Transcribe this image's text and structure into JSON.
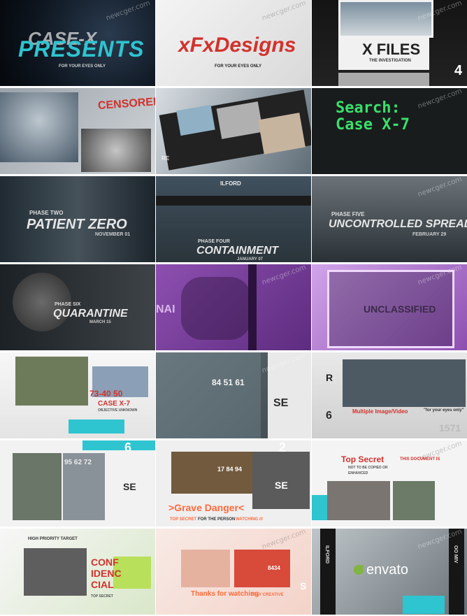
{
  "colors": {
    "cyan": "#2ec4d0",
    "red": "#d2322c",
    "green": "#39e06b",
    "purple": "#8d4fb0",
    "orange": "#ff6a3d"
  },
  "watermark": "newcger.com",
  "tiles": [
    {
      "title": "PRESENTS",
      "overlay": "CASE-X",
      "sub": "FOR YOUR EYES ONLY"
    },
    {
      "title": "xFxDesigns",
      "sub": "FOR YOUR EYES ONLY"
    },
    {
      "title": "X FILES",
      "sub": "THE INVESTIGATION",
      "corner": "4"
    },
    {
      "title": "CENSORED"
    },
    {
      "text": "RE"
    },
    {
      "line1": "Search:",
      "line2": "Case X-7"
    },
    {
      "kicker": "PHASE TWO",
      "title": "PATIENT ZERO",
      "sub": "NOVEMBER 01"
    },
    {
      "top": "ILFORD",
      "kicker": "PHASE FOUR",
      "title": "CONTAINMENT",
      "sub": "JANUARY 07"
    },
    {
      "kicker": "PHASE FIVE",
      "title": "UNCONTROLLED SPREAD",
      "sub": "FEBRUARY 29"
    },
    {
      "kicker": "PHASE SIX",
      "title": "QUARANTINE",
      "sub": "MARCH 15"
    },
    {
      "text": "NAI"
    },
    {
      "title": "UNCLASSIFIED"
    },
    {
      "numbers": "73-40 50",
      "title": "CASE X-7",
      "sub": "OBJECTIVE UNKNOWN"
    },
    {
      "numbers": "84 51 61",
      "corner": "SE"
    },
    {
      "letter": "R",
      "corner": "6",
      "title": "Multiple Image/Video",
      "note": "\"for your eyes only\"",
      "nums": "1571"
    },
    {
      "corner": "6",
      "numbers": "95 62 72",
      "label": "SE"
    },
    {
      "corner": "2",
      "numbers": "17 84 94",
      "label": "SE",
      "title": ">Grave Danger<",
      "sub": "TOP SECRET",
      "sub2": "FOR THE PERSON",
      "sub3": "WATCHING ///"
    },
    {
      "title": "Top Secret",
      "line1": "THIS DOCUMENT IS",
      "line2": "NOT TO BE COPIED OR",
      "line3": "ENHANCED"
    },
    {
      "kicker": "HIGH PRIORITY TARGET",
      "title1": "CONF",
      "title2": "IDENC",
      "title3": "CIAL",
      "sub": "TOP SECRET"
    },
    {
      "title": "Thanks for watching",
      "sub": "STAY CREATIVE",
      "num": "8434",
      "corner": "S"
    },
    {
      "brand": "envato",
      "side": "ILFORD",
      "side2": "OO MIV"
    }
  ]
}
